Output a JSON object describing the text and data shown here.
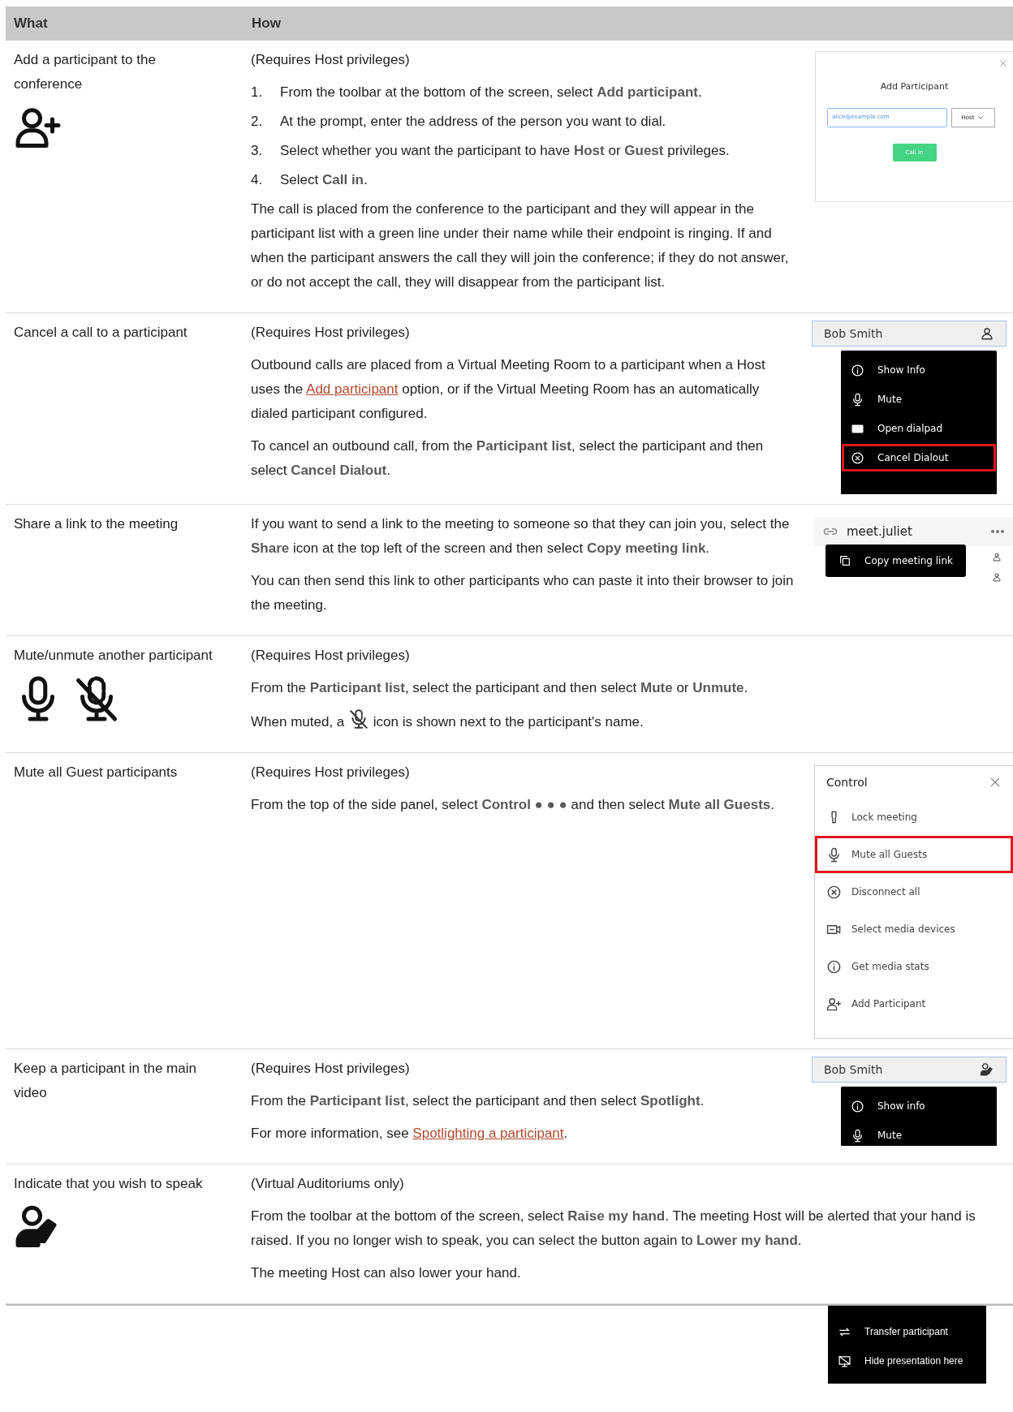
{
  "table": {
    "columns": [
      "What",
      "How"
    ],
    "rows": [
      {
        "what": "Add a participant to the conference",
        "how": [
          {
            "kind": "para",
            "parts": [
              {
                "kind": "text",
                "text": "(Requires Host privileges)"
              }
            ]
          },
          {
            "kind": "steps",
            "items": [
              {
                "num": "1.",
                "text": "From the toolbar at the bottom of the screen, select **Add participant**."
              },
              {
                "num": "2.",
                "text": "At the prompt, enter the address of the person you want to dial."
              },
              {
                "num": "3.",
                "text": "Select whether you want the participant to have **Host** or **Guest** privileges."
              },
              {
                "num": "4.",
                "text": "Select **Call in**."
              }
            ]
          },
          {
            "kind": "para",
            "parts": [
              {
                "kind": "text",
                "text": "The call is placed from the conference to the participant and they will appear in the participant list with a green line under their name while their endpoint is ringing. If and when the participant answers the call they will join the conference; if they do not answer, or do not accept the call, they will disappear from the participant list."
              }
            ]
          }
        ],
        "figure": {
          "kind": "dialog",
          "title": "Add Participant",
          "value": "alice@example.com",
          "role": "Host",
          "button": "Call in"
        }
      },
      {
        "what": "Cancel a call to a participant",
        "how": [
          {
            "kind": "para",
            "parts": [
              {
                "kind": "text",
                "text": "(Requires Host privileges)"
              }
            ]
          },
          {
            "kind": "para",
            "parts": [
              {
                "kind": "text",
                "text": "Outbound calls are placed from a Virtual Meeting Room to a participant when a Host uses the "
              },
              {
                "kind": "link",
                "text": "Add participant"
              },
              {
                "kind": "text",
                "text": " option, or if the Virtual Meeting Room has an automatically dialed participant configured."
              }
            ]
          },
          {
            "kind": "para",
            "parts": [
              {
                "kind": "text",
                "text": "To cancel an outbound call, from the **Participant list**, select the participant and then select **Cancel Dialout**."
              }
            ]
          }
        ],
        "figure": {
          "kind": "menu",
          "name": "Bob Smith",
          "items": [
            {
              "label": "Show Info",
              "highlighted": false
            },
            {
              "label": "Mute",
              "highlighted": false
            },
            {
              "label": "Open dialpad",
              "highlighted": false
            },
            {
              "label": "Cancel Dialout",
              "highlighted": true
            }
          ]
        }
      },
      {
        "what": "Share a link to the meeting",
        "how": [
          {
            "kind": "para",
            "parts": [
              {
                "kind": "text",
                "text": "If you want to send a link to the meeting to someone so that they can join you, select the **Share** icon at the top left of the screen and then select **Copy meeting link**."
              }
            ]
          },
          {
            "kind": "para",
            "parts": [
              {
                "kind": "text",
                "text": "You can then send this link to other participants who can paste it into their browser to join the meeting."
              }
            ]
          }
        ],
        "figure": {
          "kind": "share",
          "room": "meet.juliet",
          "tooltip": "Copy meeting link"
        }
      },
      {
        "what": "Mute/unmute another participant",
        "how": [
          {
            "kind": "para",
            "parts": [
              {
                "kind": "text",
                "text": "(Requires Host privileges)"
              }
            ]
          },
          {
            "kind": "para",
            "parts": [
              {
                "kind": "text",
                "text": "From the **Participant list**, select the participant and then select **Mute** or **Unmute**."
              }
            ]
          },
          {
            "kind": "para",
            "parts": [
              {
                "kind": "text",
                "text": "When muted, a "
              },
              {
                "kind": "icon"
              },
              {
                "kind": "text",
                "text": " icon is shown next to the participant's name."
              }
            ]
          }
        ]
      },
      {
        "what": "Mute all Guest participants",
        "how": [
          {
            "kind": "para",
            "parts": [
              {
                "kind": "text",
                "text": "(Requires Host privileges)"
              }
            ]
          },
          {
            "kind": "para",
            "parts": [
              {
                "kind": "text",
                "text": "From the top of the side panel, select **Control ● ● ●** and then select **Mute all Guests**."
              }
            ]
          }
        ],
        "figure": {
          "kind": "panel",
          "title": "Control",
          "items": [
            {
              "label": "Lock meeting",
              "highlighted": false
            },
            {
              "label": "Mute all Guests",
              "highlighted": true
            },
            {
              "label": "Disconnect all",
              "highlighted": false
            },
            {
              "label": "Select media devices",
              "highlighted": false
            },
            {
              "label": "Get media stats",
              "highlighted": false
            },
            {
              "label": "Add Participant",
              "highlighted": false
            }
          ]
        }
      },
      {
        "what": "Keep a participant in the main video",
        "how": [
          {
            "kind": "para",
            "parts": [
              {
                "kind": "text",
                "text": "(Requires Host privileges)"
              }
            ]
          },
          {
            "kind": "para",
            "parts": [
              {
                "kind": "text",
                "text": "From the **Participant list**, select the participant and then select **Spotlight**."
              }
            ]
          },
          {
            "kind": "para",
            "parts": [
              {
                "kind": "text",
                "text": "For more information, see "
              },
              {
                "kind": "link",
                "text": "Spotlighting a participant"
              },
              {
                "kind": "text",
                "text": "."
              }
            ]
          }
        ],
        "figure": {
          "kind": "menu",
          "name": "Bob Smith",
          "items": [
            {
              "label": "Show info",
              "highlighted": false
            },
            {
              "label": "Mute",
              "highlighted": false
            }
          ]
        }
      },
      {
        "what": "Indicate that you wish to speak",
        "how": [
          {
            "kind": "para",
            "parts": [
              {
                "kind": "text",
                "text": "(Virtual Auditoriums only)"
              }
            ]
          },
          {
            "kind": "para",
            "parts": [
              {
                "kind": "text",
                "text": "From the toolbar at the bottom of the screen, select **Raise my hand**. The meeting Host will be alerted that your hand is raised. If you no longer wish to speak, you can select the button again to **Lower my hand**."
              }
            ]
          },
          {
            "kind": "para",
            "parts": [
              {
                "kind": "text",
                "text": "The meeting Host can also lower your hand."
              }
            ]
          }
        ]
      }
    ]
  },
  "overflow_menu": {
    "items": [
      {
        "label": "Transfer participant"
      },
      {
        "label": "Hide presentation here"
      }
    ]
  }
}
